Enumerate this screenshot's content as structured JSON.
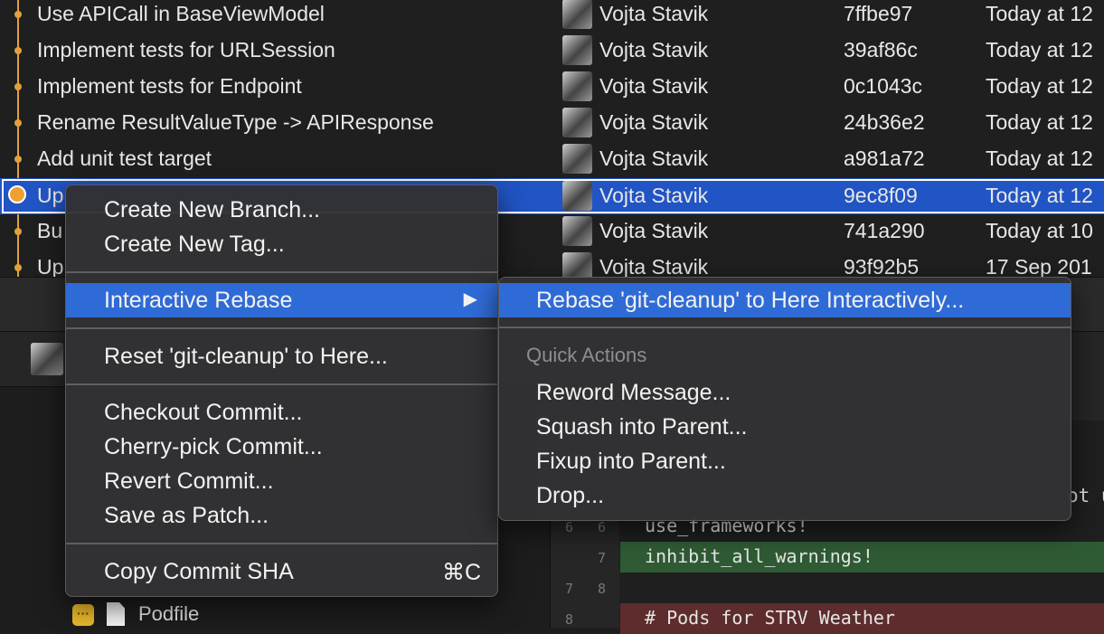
{
  "commits": [
    {
      "message": "Use APICall in BaseViewModel",
      "author": "Vojta Stavik",
      "sha": "7ffbe97",
      "date": "Today at 12"
    },
    {
      "message": "Implement tests for URLSession",
      "author": "Vojta Stavik",
      "sha": "39af86c",
      "date": "Today at 12"
    },
    {
      "message": "Implement tests for Endpoint",
      "author": "Vojta Stavik",
      "sha": "0c1043c",
      "date": "Today at 12"
    },
    {
      "message": "Rename ResultValueType -> APIResponse",
      "author": "Vojta Stavik",
      "sha": "24b36e2",
      "date": "Today at 12"
    },
    {
      "message": "Add unit test target",
      "author": "Vojta Stavik",
      "sha": "a981a72",
      "date": "Today at 12"
    },
    {
      "message": "Up",
      "author": "Vojta Stavik",
      "sha": "9ec8f09",
      "date": "Today at 12"
    },
    {
      "message": "Bu",
      "author": "Vojta Stavik",
      "sha": "741a290",
      "date": "Today at 10"
    },
    {
      "message": "Up",
      "author": "Vojta Stavik",
      "sha": "93f92b5",
      "date": "17 Sep 201"
    }
  ],
  "context_menu": {
    "create_branch": "Create New Branch...",
    "create_tag": "Create New Tag...",
    "interactive_rebase": "Interactive Rebase",
    "reset": "Reset 'git-cleanup' to Here...",
    "checkout": "Checkout Commit...",
    "cherry_pick": "Cherry-pick Commit...",
    "revert": "Revert Commit...",
    "save_patch": "Save as Patch...",
    "copy_sha": "Copy Commit SHA",
    "copy_sha_shortcut": "⌘C"
  },
  "submenu": {
    "rebase_here": "Rebase 'git-cleanup' to Here Interactively...",
    "quick_actions_title": "Quick Actions",
    "reword": "Reword Message...",
    "squash": "Squash into Parent...",
    "fixup": "Fixup into Parent...",
    "drop": "Drop..."
  },
  "file": {
    "badge": "···",
    "name": "Podfile"
  },
  "diff": {
    "lines": [
      {
        "old": "6",
        "new": "6",
        "code": "use_frameworks!",
        "kind": "context"
      },
      {
        "old": "",
        "new": "7",
        "code": "inhibit_all_warnings!",
        "kind": "added"
      },
      {
        "old": "7",
        "new": "8",
        "code": "",
        "kind": "context"
      },
      {
        "old": "8",
        "new": "",
        "code": "# Pods for STRV Weather",
        "kind": "removed"
      }
    ],
    "peek_text": "ot u"
  },
  "colors": {
    "selection": "#2154c4",
    "menu_highlight": "#2f6bd6",
    "graph": "#e0a040"
  }
}
